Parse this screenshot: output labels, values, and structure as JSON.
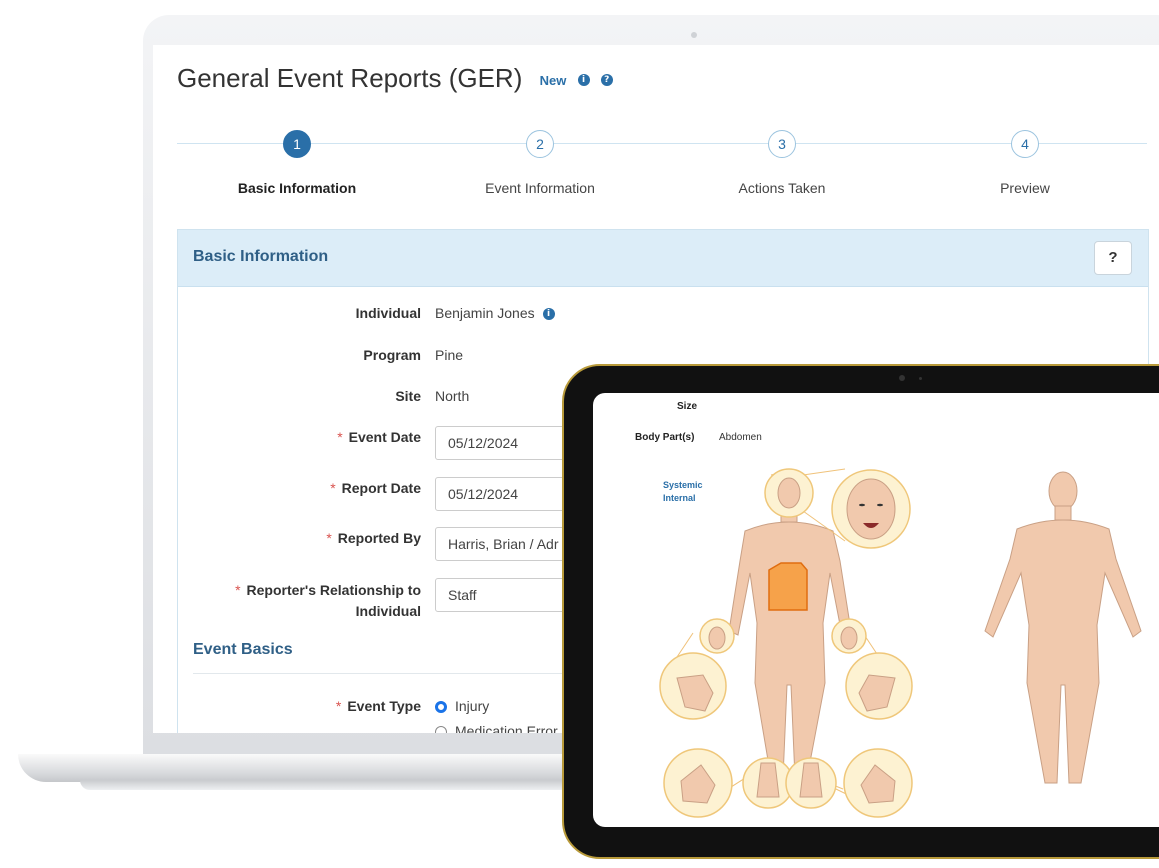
{
  "page": {
    "title": "General Event Reports (GER)",
    "badge": "New"
  },
  "stepper": {
    "steps": [
      {
        "number": "1",
        "label": "Basic Information",
        "active": true
      },
      {
        "number": "2",
        "label": "Event Information",
        "active": false
      },
      {
        "number": "3",
        "label": "Actions Taken",
        "active": false
      },
      {
        "number": "4",
        "label": "Preview",
        "active": false
      }
    ]
  },
  "panel": {
    "title": "Basic Information",
    "help_label": "?"
  },
  "form": {
    "individual_label": "Individual",
    "individual_value": "Benjamin Jones",
    "program_label": "Program",
    "program_value": "Pine",
    "site_label": "Site",
    "site_value": "North",
    "event_date_label": "Event Date",
    "event_date_value": "05/12/2024",
    "report_date_label": "Report Date",
    "report_date_value": "05/12/2024",
    "reported_by_label": "Reported By",
    "reported_by_value": "Harris, Brian / Adr",
    "relationship_label_1": "Reporter's Relationship to",
    "relationship_label_2": "Individual",
    "relationship_value": "Staff",
    "section_event_basics": "Event Basics",
    "event_type_label": "Event Type",
    "event_type_options": [
      "Injury",
      "Medication Error"
    ]
  },
  "tablet": {
    "size_label": "Size",
    "body_parts_label": "Body Part(s)",
    "body_parts_value": "Abdomen",
    "links": [
      "Systemic",
      "Internal"
    ]
  },
  "colors": {
    "accent": "#2a6fa8",
    "panel_header_bg": "#dcedf8",
    "required": "#d9534f",
    "skin": "#f1c9ad",
    "highlight": "#f6a24a"
  },
  "icons": [
    "info-icon",
    "question-icon",
    "help-icon",
    "radio-selected-icon",
    "radio-icon"
  ]
}
